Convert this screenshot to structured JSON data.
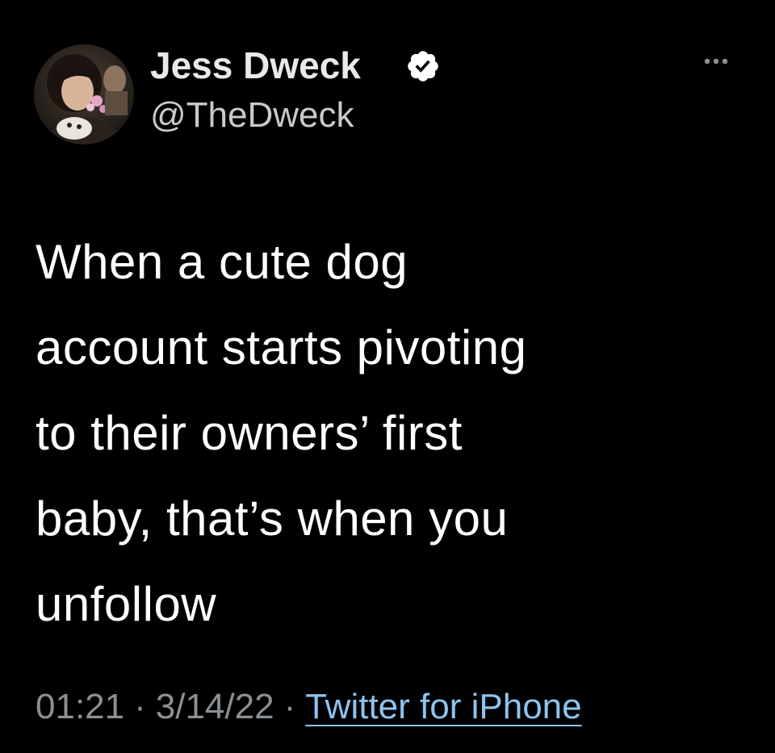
{
  "author": {
    "display_name": "Jess Dweck",
    "handle": "@TheDweck",
    "verified": true,
    "avatar_icon": "profile-photo-icon",
    "verified_icon": "verified-badge-icon"
  },
  "menu": {
    "icon": "more-options-icon"
  },
  "tweet": {
    "text": "When a cute dog\naccount starts pivoting\nto their owners’ first\nbaby, that’s when you\nunfollow"
  },
  "meta": {
    "time": "01:21",
    "separator": "·",
    "date": "3/14/22",
    "source": "Twitter for iPhone"
  },
  "colors": {
    "background": "#000000",
    "text": "#ffffff",
    "secondary_text": "#8b9095",
    "link": "#8ec3ee",
    "verified_badge": "#ffffff"
  }
}
